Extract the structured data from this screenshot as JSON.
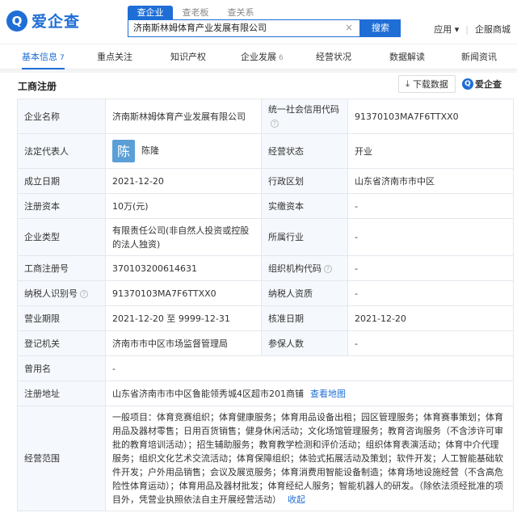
{
  "header": {
    "logo_mark": "Q",
    "logo_text": "爱企查",
    "search_tabs": [
      "查企业",
      "查老板",
      "查关系"
    ],
    "search_value": "济南斯林姆体育产业发展有限公司",
    "search_button": "搜索",
    "right_links": [
      "应用",
      "企服商城"
    ]
  },
  "nav": {
    "items": [
      {
        "label": "基本信息",
        "count": "7"
      },
      {
        "label": "重点关注",
        "count": ""
      },
      {
        "label": "知识产权",
        "count": ""
      },
      {
        "label": "企业发展",
        "count": "6"
      },
      {
        "label": "经营状况",
        "count": ""
      },
      {
        "label": "数据解读",
        "count": ""
      },
      {
        "label": "新闻资讯",
        "count": ""
      }
    ]
  },
  "section": {
    "title": "工商注册",
    "download_label": "下载数据",
    "brand_label": "爱企查",
    "brand_mark": "Q"
  },
  "table": {
    "company_name_label": "企业名称",
    "company_name": "济南斯林姆体育产业发展有限公司",
    "credit_code_label": "统一社会信用代码",
    "credit_code": "91370103MA7F6TTXX0",
    "legal_rep_label": "法定代表人",
    "legal_rep_avatar": "陈",
    "legal_rep": "陈隆",
    "status_label": "经营状态",
    "status": "开业",
    "founded_label": "成立日期",
    "founded": "2021-12-20",
    "district_label": "行政区划",
    "district": "山东省济南市市中区",
    "reg_capital_label": "注册资本",
    "reg_capital": "10万(元)",
    "paid_capital_label": "实缴资本",
    "paid_capital": "-",
    "company_type_label": "企业类型",
    "company_type": "有限责任公司(非自然人投资或控股的法人独资)",
    "industry_label": "所属行业",
    "industry": "-",
    "reg_no_label": "工商注册号",
    "reg_no": "370103200614631",
    "org_code_label": "组织机构代码",
    "org_code": "-",
    "taxpayer_id_label": "纳税人识别号",
    "taxpayer_id": "91370103MA7F6TTXX0",
    "taxpayer_qual_label": "纳税人资质",
    "taxpayer_qual": "-",
    "term_label": "营业期限",
    "term": "2021-12-20 至 9999-12-31",
    "approved_label": "核准日期",
    "approved": "2021-12-20",
    "authority_label": "登记机关",
    "authority": "济南市市中区市场监督管理局",
    "insured_label": "参保人数",
    "insured": "-",
    "former_name_label": "曾用名",
    "former_name": "-",
    "address_label": "注册地址",
    "address": "山东省济南市市中区鲁能领秀城4区超市201商铺",
    "address_link": "查看地图",
    "scope_label": "经营范围",
    "scope": "一般项目：体育竞赛组织；体育健康服务；体育用品设备出租；园区管理服务；体育赛事策划；体育用品及器材零售；日用百货销售；健身休闲活动；文化场馆管理服务；教育咨询服务（不含涉许可审批的教育培训活动）；招生辅助服务；教育教学检测和评价活动；组织体育表演活动；体育中介代理服务；组织文化艺术交流活动；体育保障组织；体验式拓展活动及策划；软件开发；人工智能基础软件开发；户外用品销售；会议及展览服务；体育消费用智能设备制造；体育场地设施经营（不含高危险性体育运动）；体育用品及器材批发；体育经纪人服务；智能机器人的研发。（除依法须经批准的项目外，凭营业执照依法自主开展经营活动）",
    "scope_link": "收起"
  }
}
